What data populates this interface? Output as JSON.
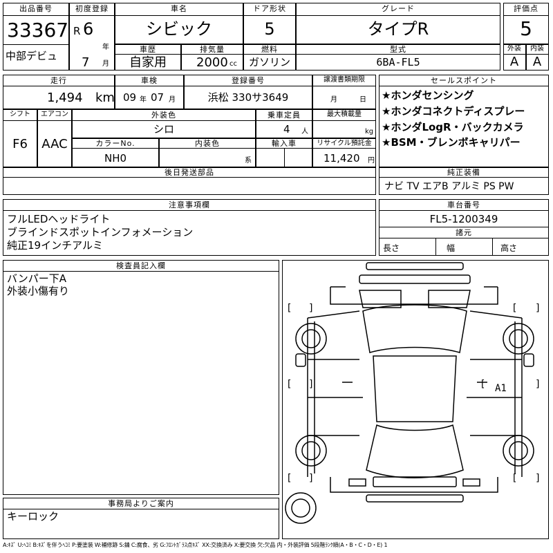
{
  "top": {
    "lot_no_label": "出品番号",
    "lot_no": "33367",
    "debut": "中部デビュ",
    "first_reg_label": "初度登録",
    "era_letter": "R",
    "year_num": "6",
    "year_unit": "年",
    "month_num": "7",
    "month_unit": "月",
    "car_name_label": "車名",
    "car_name": "シビック",
    "doors_label": "ドア形状",
    "doors": "5",
    "grade_label": "グレード",
    "grade": "タイプR",
    "score_label": "評価点",
    "score": "5",
    "history_label": "車歴",
    "history": "自家用",
    "displacement_label": "排気量",
    "displacement": "2000",
    "displacement_unit": "cc",
    "fuel_label": "燃料",
    "fuel": "ガソリン",
    "model_label": "型式",
    "model": "6BA-FL5",
    "ext_label": "外装",
    "ext_grade": "A",
    "int_label": "内装",
    "int_grade": "A"
  },
  "row2": {
    "mileage_label": "走行",
    "mileage": "1,494",
    "mileage_unit": "km",
    "inspection_label": "車検",
    "insp_year": "09",
    "insp_year_unit": "年",
    "insp_month": "07",
    "insp_month_unit": "月",
    "reg_no_label": "登録番号",
    "reg_no": "浜松 330サ3649",
    "transfer_label": "譲渡書類期限",
    "transfer_month": "月",
    "transfer_day": "日",
    "shift_label": "シフト",
    "shift": "F6",
    "ac_label": "エアコン",
    "ac": "AAC",
    "color_label": "外装色",
    "color": "シロ",
    "capacity_label": "乗車定員",
    "capacity": "4",
    "capacity_unit": "人",
    "max_load_label": "最大積載量",
    "max_load_unit": "kg",
    "color_no_label": "カラーNo.",
    "color_no": "NH0",
    "interior_color_label": "内装色",
    "interior_color_unit": "系",
    "import_label": "輸入車",
    "recycle_label": "リサイクル預託金",
    "recycle": "11,420",
    "recycle_unit": "円",
    "later_parts_label": "後日発送部品"
  },
  "sales_points": {
    "label": "セールスポイント",
    "items": [
      "★ホンダセンシング",
      "★ホンダコネクトディスプレー",
      "★ホンダLogR・バックカメラ",
      "★BSM・ブレンボキャリパー"
    ]
  },
  "equipment": {
    "label": "純正装備",
    "value": "ナビ TV エアB アルミ PS PW"
  },
  "notes": {
    "label": "注意事項欄",
    "lines": [
      "フルLEDヘッドライト",
      "ブラインドスポットインフォメーション",
      "純正19インチアルミ"
    ]
  },
  "chassis": {
    "label": "車台番号",
    "value": "FL5-1200349",
    "dims_label": "諸元",
    "length": "長さ",
    "width": "幅",
    "height": "高さ"
  },
  "inspector": {
    "label": "検査員記入欄",
    "lines": [
      "バンパー下A",
      "外装小傷有り"
    ]
  },
  "diagram": {
    "mark": "A1",
    "bracket_left": "[",
    "bracket_right": "]"
  },
  "office": {
    "label": "事務局よりご案内",
    "value": "キーロック"
  },
  "legend": "A:ｷｽﾞ U:ﾍｺﾐ B:ｷｽﾞを伴うﾍｺﾐ P:要塗装 W:補修跡 S:錆 C:腐食、劣 G:ﾌﾛﾝﾄｶﾞﾗｽ点ｷｽﾞ XX:交換済み X:要交換 欠:欠品 内・外装評価 5段階ﾗﾝｸ順(A・B・C・D・E) 1"
}
